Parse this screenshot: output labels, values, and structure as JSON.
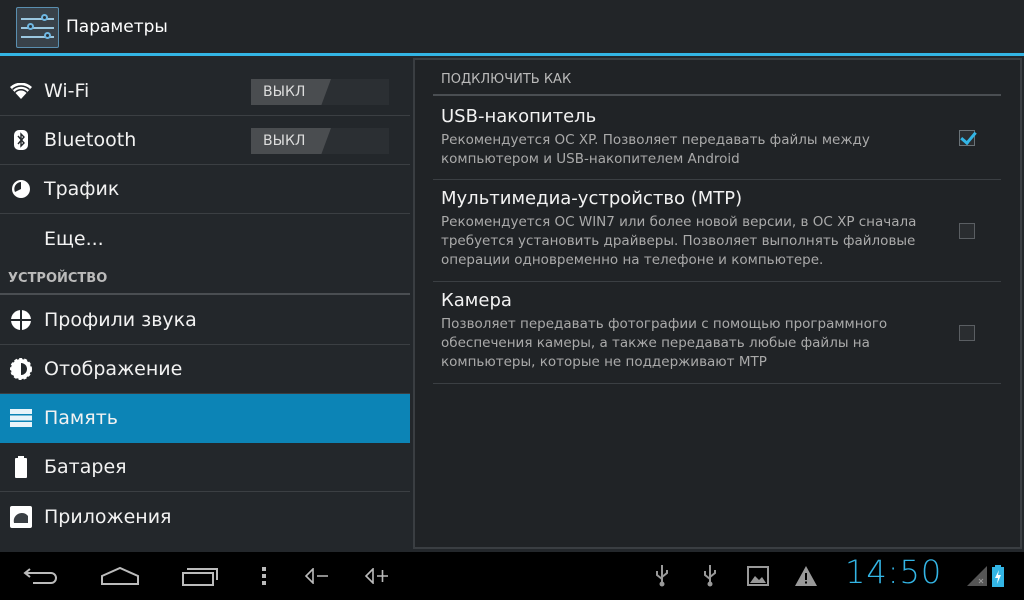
{
  "actionbar": {
    "title": "Параметры",
    "icon": "settings-sliders-icon"
  },
  "sidebar": {
    "items": [
      {
        "label": "Wi-Fi",
        "icon": "wifi-icon",
        "toggle": "ВЫКЛ"
      },
      {
        "label": "Bluetooth",
        "icon": "bluetooth-icon",
        "toggle": "ВЫКЛ"
      },
      {
        "label": "Трафик",
        "icon": "data-usage-icon"
      },
      {
        "label": "Еще..."
      },
      {
        "label": "Профили звука",
        "icon": "sound-profile-icon"
      },
      {
        "label": "Отображение",
        "icon": "display-brightness-icon"
      },
      {
        "label": "Память",
        "icon": "storage-icon",
        "selected": true
      },
      {
        "label": "Батарея",
        "icon": "battery-icon"
      },
      {
        "label": "Приложения",
        "icon": "apps-icon"
      }
    ],
    "section_device": "УСТРОЙСТВО"
  },
  "panel": {
    "header": "ПОДКЛЮЧИТЬ КАК",
    "options": [
      {
        "title": "USB-накопитель",
        "desc": "Рекомендуется ОС XP. Позволяет передавать файлы между компьютером и USB-накопителем Android",
        "checked": true
      },
      {
        "title": "Мультимедиа-устройство (MTP)",
        "desc": "Рекомендуется ОС WIN7 или более новой версии, в ОС XP сначала требуется установить драйверы. Позволяет выполнять файловые операции одновременно на телефоне и компьютере.",
        "checked": false
      },
      {
        "title": "Камера",
        "desc": "Позволяет передавать фотографии с помощью программного обеспечения камеры, а также передавать любые файлы на компьютеры, которые не поддерживают MTP",
        "checked": false
      }
    ]
  },
  "statusbar": {
    "time": "14:50",
    "accent": "#33b5e5",
    "icons": [
      "usb-icon",
      "usb-icon",
      "gallery-icon",
      "warning-icon",
      "signal-no-sim-icon",
      "battery-charging-icon"
    ]
  },
  "navbar": {
    "buttons": [
      "back-icon",
      "home-icon",
      "recent-apps-icon",
      "menu-icon",
      "volume-down-icon",
      "volume-up-icon"
    ]
  }
}
